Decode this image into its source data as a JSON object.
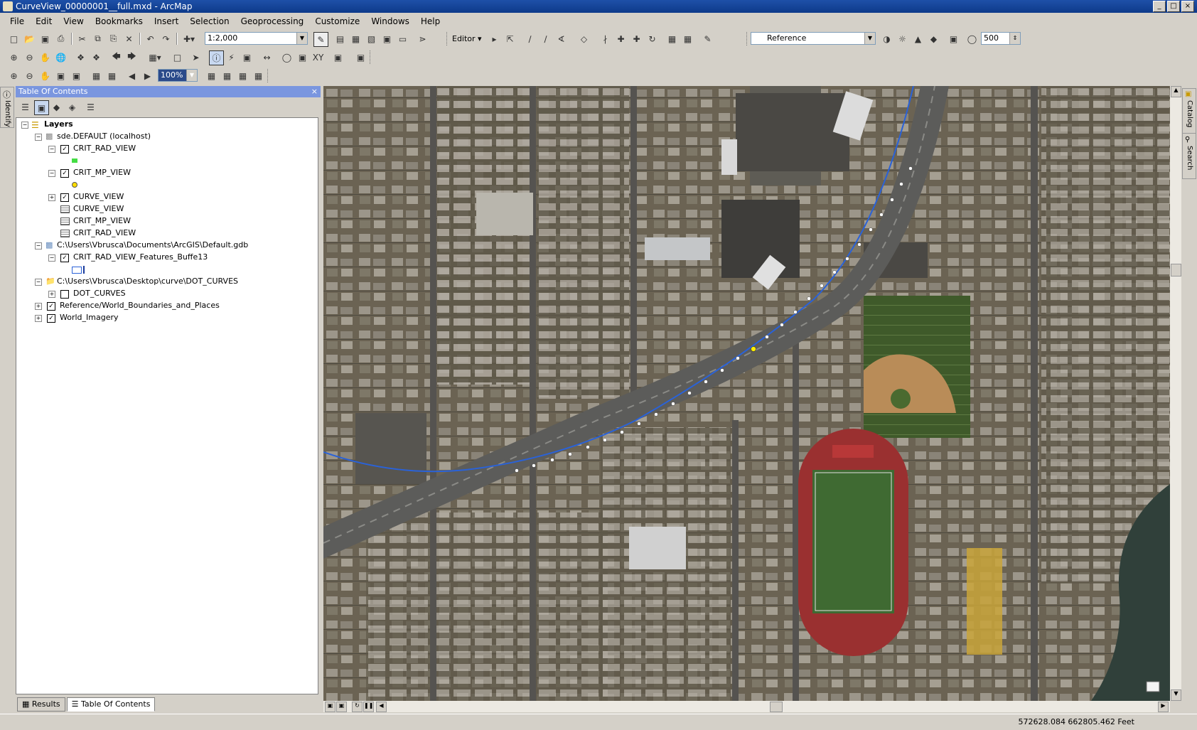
{
  "window": {
    "title": "CurveView_00000001__full.mxd - ArcMap",
    "controls": [
      "_",
      "□",
      "×"
    ]
  },
  "menus": [
    "File",
    "Edit",
    "View",
    "Bookmarks",
    "Insert",
    "Selection",
    "Geoprocessing",
    "Customize",
    "Windows",
    "Help"
  ],
  "toolbar": {
    "scale": "1:2,000",
    "editor_label": "Editor ▾",
    "layer_combo": "Reference",
    "transparency": "500",
    "zoom_percent": "100%"
  },
  "toc": {
    "title": "Table Of Contents",
    "tree": [
      {
        "label": "Layers"
      },
      {
        "label": "sde.DEFAULT (localhost)"
      },
      {
        "label": "CRIT_RAD_VIEW"
      },
      {
        "label": "CRIT_MP_VIEW"
      },
      {
        "label": "CURVE_VIEW"
      },
      {
        "label": "CURVE_VIEW"
      },
      {
        "label": "CRIT_MP_VIEW"
      },
      {
        "label": "CRIT_RAD_VIEW"
      },
      {
        "label": "C:\\Users\\Vbrusca\\Documents\\ArcGIS\\Default.gdb"
      },
      {
        "label": "CRIT_RAD_VIEW_Features_Buffe13"
      },
      {
        "label": "C:\\Users\\Vbrusca\\Desktop\\curve\\DOT_CURVES"
      },
      {
        "label": "DOT_CURVES"
      },
      {
        "label": "Reference/World_Boundaries_and_Places"
      },
      {
        "label": "World_Imagery"
      }
    ],
    "tabs": [
      "Results",
      "Table Of Contents"
    ]
  },
  "side_tabs": {
    "left": "Identify",
    "right_1": "Catalog",
    "right_2": "Search"
  },
  "status": {
    "coordinates": "572628.084  662805.462 Feet"
  },
  "colors": {
    "curve_line": "#2a62d8",
    "point_marker": "#ffffff",
    "selected_point": "#ffee00",
    "road": "#5a5a58",
    "field": "#4b5e2c",
    "track": "#a22c2c",
    "legend_green": "#44dd44"
  }
}
